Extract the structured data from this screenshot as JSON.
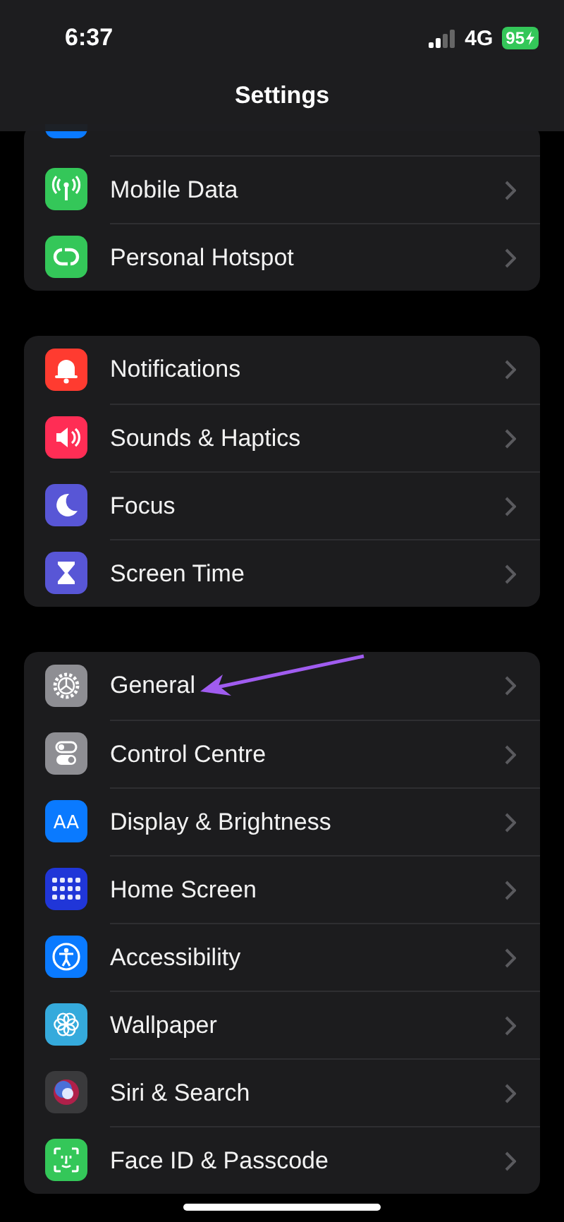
{
  "status_bar": {
    "time": "6:37",
    "network": "4G",
    "battery": "95",
    "charging": true
  },
  "title": "Settings",
  "groups": [
    {
      "cut_top": true,
      "items": [
        {
          "label": "Mobile Data",
          "kind": "antenna",
          "color": "#34c759"
        },
        {
          "label": "Personal Hotspot",
          "kind": "hotspot",
          "color": "#34c759"
        }
      ]
    },
    {
      "cut_top": false,
      "items": [
        {
          "label": "Notifications",
          "kind": "bell",
          "color": "#ff3b30"
        },
        {
          "label": "Sounds & Haptics",
          "kind": "speaker",
          "color": "#ff2d55"
        },
        {
          "label": "Focus",
          "kind": "moon",
          "color": "#5856d6"
        },
        {
          "label": "Screen Time",
          "kind": "hourglass",
          "color": "#5856d6"
        }
      ]
    },
    {
      "cut_top": false,
      "items": [
        {
          "label": "General",
          "kind": "gear",
          "color": "#8e8e93"
        },
        {
          "label": "Control Centre",
          "kind": "toggles",
          "color": "#8e8e93"
        },
        {
          "label": "Display & Brightness",
          "kind": "text",
          "icon_text": "AA",
          "color": "#0a7aff"
        },
        {
          "label": "Home Screen",
          "kind": "grid",
          "color": "#2036d8"
        },
        {
          "label": "Accessibility",
          "kind": "person",
          "color": "#0a7aff"
        },
        {
          "label": "Wallpaper",
          "kind": "flower",
          "color": "#35aadc"
        },
        {
          "label": "Siri & Search",
          "kind": "orb",
          "color": "#3a3a3c"
        },
        {
          "label": "Face ID & Passcode",
          "kind": "face",
          "color": "#34c759"
        }
      ]
    }
  ]
}
